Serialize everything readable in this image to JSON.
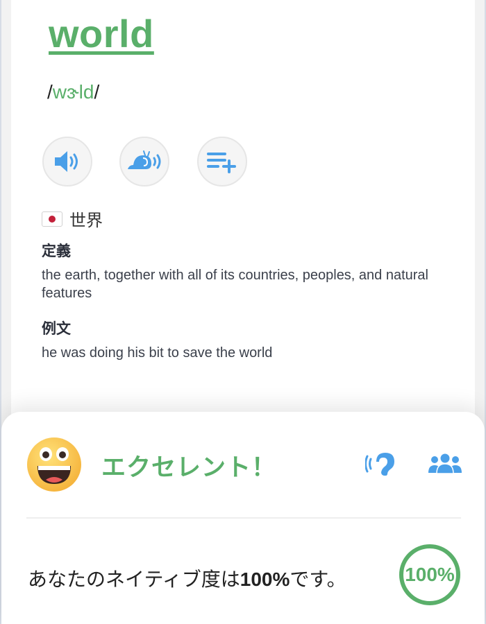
{
  "word": {
    "headword": "world",
    "phonetic_open": "/",
    "phonetic_ipa": "wɝld",
    "phonetic_close": "/"
  },
  "actions": {
    "play_icon": "speaker-icon",
    "slow_icon": "snail-speaker-icon",
    "add_icon": "playlist-add-icon"
  },
  "translation": {
    "flag_icon": "japan-flag-icon",
    "text": "世界"
  },
  "definition": {
    "label": "定義",
    "text": "the earth, together with all of its countries, peoples, and natural features"
  },
  "example": {
    "label": "例文",
    "text": "he was doing his bit to save the world"
  },
  "result": {
    "emoji_icon": "grinning-face-icon",
    "verdict": "エクセレント！",
    "listen_icon": "ear-icon",
    "community_icon": "people-icon",
    "native_prefix": "あなたのネイティブ度は",
    "native_value": "100%",
    "native_suffix": "です。",
    "score_percent": 100,
    "score_label": "100%"
  },
  "colors": {
    "accent_green": "#5aaf6a",
    "icon_blue": "#4a9fe8"
  }
}
